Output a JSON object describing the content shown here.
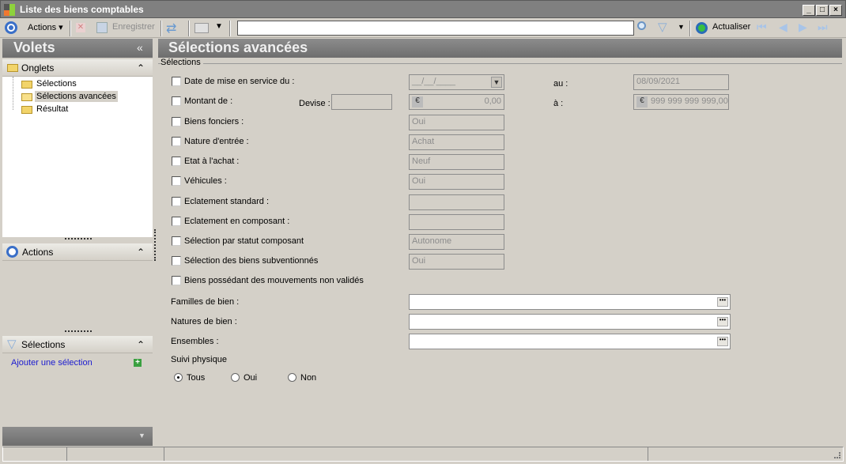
{
  "window": {
    "title": "Liste des biens comptables",
    "buttons": [
      "_",
      "□",
      "×"
    ]
  },
  "toolbar": {
    "actions": "Actions",
    "save": "Enregistrer",
    "search_value": "",
    "refresh": "Actualiser"
  },
  "left": {
    "title": "Volets",
    "collapse": "«",
    "tabs_panel": {
      "title": "Onglets",
      "items": [
        "Sélections",
        "Sélections avancées",
        "Résultat"
      ],
      "selected": 1
    },
    "actions_panel": {
      "title": "Actions"
    },
    "selections_panel": {
      "title": "Sélections",
      "add_link": "Ajouter une sélection"
    }
  },
  "main": {
    "title": "Sélections avancées",
    "group": "Sélections",
    "rows": [
      {
        "label": "Date de mise en service du :",
        "value": "__/__/____",
        "to_label": "au :",
        "to_value": "08/09/2021"
      },
      {
        "label": "Montant de :",
        "devise_label": "Devise :",
        "devise_value": "",
        "value": "0,00",
        "to_label": "à :",
        "to_value": "999 999 999 999,00"
      },
      {
        "label": "Biens fonciers :",
        "value": "Oui"
      },
      {
        "label": "Nature d'entrée :",
        "value": "Achat"
      },
      {
        "label": "Etat à l'achat :",
        "value": "Neuf"
      },
      {
        "label": "Véhicules :",
        "value": "Oui"
      },
      {
        "label": "Eclatement standard :",
        "value": ""
      },
      {
        "label": "Eclatement en composant :",
        "value": ""
      },
      {
        "label": "Sélection par statut composant",
        "value": "Autonome"
      },
      {
        "label": "Sélection des biens subventionnés",
        "value": "Oui"
      },
      {
        "label": "Biens possédant des mouvements non validés"
      }
    ],
    "lookups": [
      {
        "label": "Familles de bien :",
        "value": ""
      },
      {
        "label": "Natures de bien :",
        "value": ""
      },
      {
        "label": "Ensembles :",
        "value": ""
      }
    ],
    "suivi": {
      "label": "Suivi physique",
      "options": [
        "Tous",
        "Oui",
        "Non"
      ],
      "selected": "Tous"
    }
  }
}
